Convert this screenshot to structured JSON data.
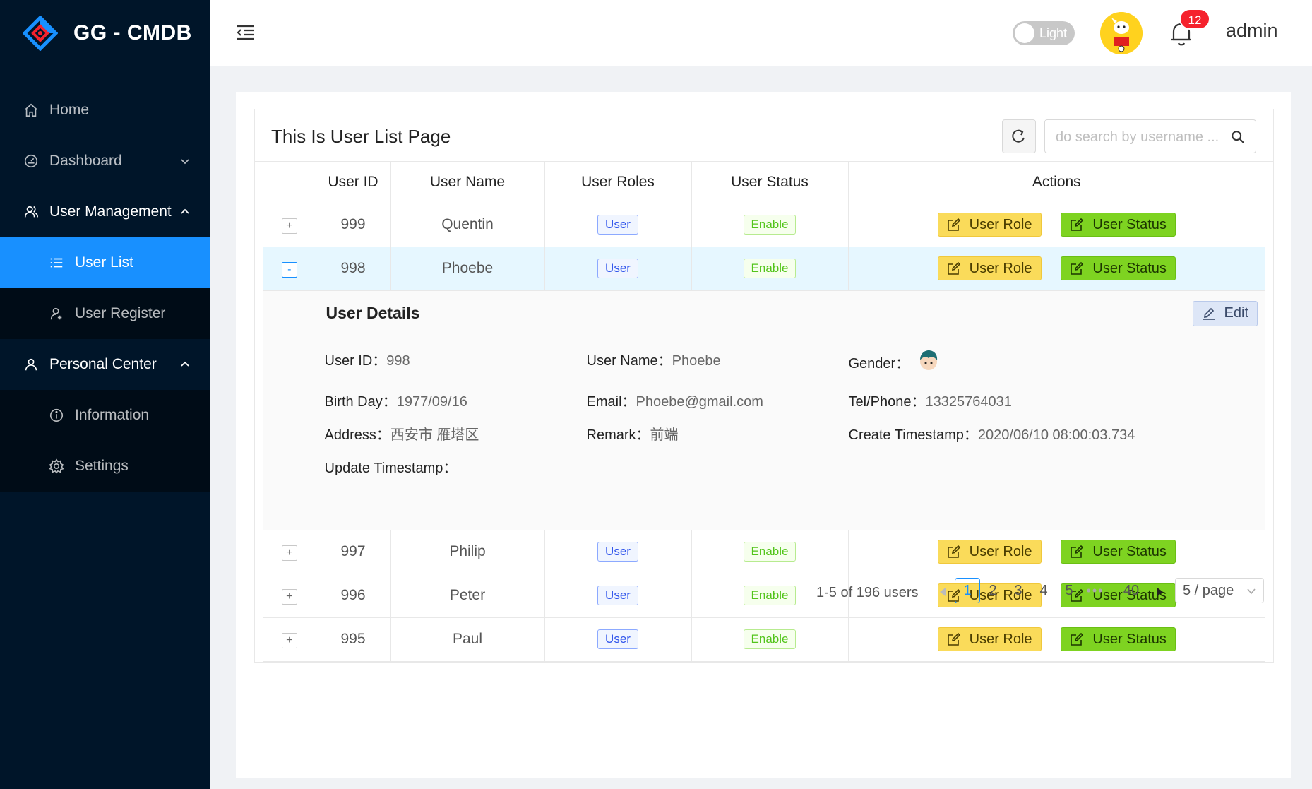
{
  "app": {
    "title": "GG - CMDB"
  },
  "sidebar": {
    "items": [
      {
        "label": "Home",
        "icon": "home-icon"
      },
      {
        "label": "Dashboard",
        "icon": "dashboard-icon"
      },
      {
        "label": "User Management",
        "icon": "user-group-icon"
      },
      {
        "label": "User List",
        "icon": "list-icon"
      },
      {
        "label": "User Register",
        "icon": "user-add-icon"
      },
      {
        "label": "Personal Center",
        "icon": "user-icon"
      },
      {
        "label": "Information",
        "icon": "info-icon"
      },
      {
        "label": "Settings",
        "icon": "gear-icon"
      }
    ]
  },
  "header": {
    "theme_label": "Light",
    "notification_count": "12",
    "user": "admin"
  },
  "page": {
    "title": "This Is User List Page",
    "search_placeholder": "do search by username ...",
    "columns": [
      "User ID",
      "User Name",
      "User Roles",
      "User Status",
      "Actions"
    ],
    "action_role": "User Role",
    "action_status": "User Status",
    "rows": [
      {
        "id": "999",
        "name": "Quentin",
        "role": "User",
        "status": "Enable",
        "expander": "+"
      },
      {
        "id": "998",
        "name": "Phoebe",
        "role": "User",
        "status": "Enable",
        "expander": "-"
      },
      {
        "id": "997",
        "name": "Philip",
        "role": "User",
        "status": "Enable",
        "expander": "+"
      },
      {
        "id": "996",
        "name": "Peter",
        "role": "User",
        "status": "Enable",
        "expander": "+"
      },
      {
        "id": "995",
        "name": "Paul",
        "role": "User",
        "status": "Enable",
        "expander": "+"
      }
    ]
  },
  "details": {
    "title": "User Details",
    "edit_label": "Edit",
    "fields": {
      "user_id": {
        "label": "User ID：",
        "value": "998"
      },
      "user_name": {
        "label": "User Name：",
        "value": "Phoebe"
      },
      "gender": {
        "label": "Gender：",
        "value": ""
      },
      "birthday": {
        "label": "Birth Day：",
        "value": "1977/09/16"
      },
      "email": {
        "label": "Email：",
        "value": "Phoebe@gmail.com"
      },
      "phone": {
        "label": "Tel/Phone：",
        "value": "13325764031"
      },
      "address": {
        "label": "Address：",
        "value": "西安市 雁塔区"
      },
      "remark": {
        "label": "Remark：",
        "value": "前端"
      },
      "create_ts": {
        "label": "Create Timestamp：",
        "value": "2020/06/10 08:00:03.734"
      },
      "update_ts": {
        "label": "Update Timestamp：",
        "value": ""
      }
    }
  },
  "pagination": {
    "total": "1-5 of 196 users",
    "pages": [
      "1",
      "2",
      "3",
      "4",
      "5"
    ],
    "ellipsis": "•••",
    "last": "40",
    "size": "5 / page"
  },
  "colors": {
    "sidebar_bg": "#001529",
    "accent": "#1890ff",
    "role_button": "#fadb5a",
    "status_button": "#7ed321"
  }
}
